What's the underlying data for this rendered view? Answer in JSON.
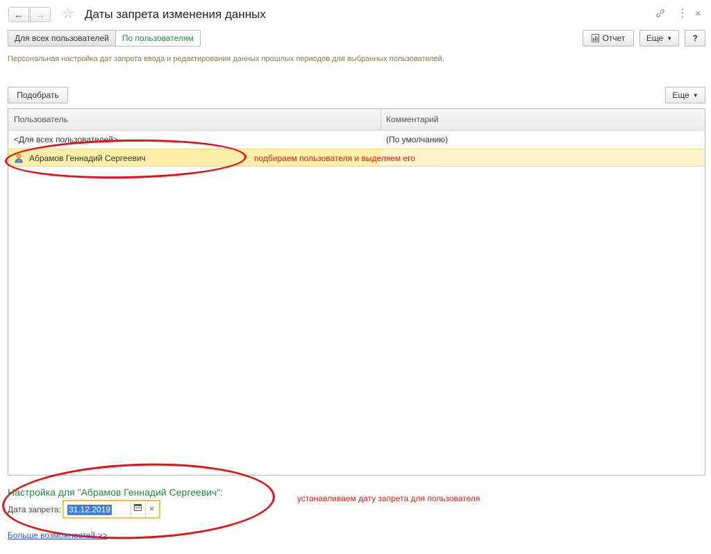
{
  "window": {
    "title": "Даты запрета изменения данных"
  },
  "tabs": [
    {
      "label": "Для всех пользователей",
      "active": false
    },
    {
      "label": "По пользователям",
      "active": true
    }
  ],
  "toolbar": {
    "report_label": "Отчет",
    "more_label": "Еще",
    "help_label": "?"
  },
  "description": "Персональная настройка дат запрета ввода и редактирования данных прошлых периодов для выбранных пользователей.",
  "list_toolbar": {
    "pick_label": "Подобрать",
    "more_label": "Еще"
  },
  "table": {
    "columns": [
      "Пользователь",
      "Комментарий"
    ],
    "rows": [
      {
        "user": "<Для всех пользователей>",
        "comment": "(По умолчанию)",
        "selected": false
      },
      {
        "user": "Абрамов Геннадий Сергеевич",
        "comment": "",
        "selected": true
      }
    ]
  },
  "annotations": {
    "row_note": "подбираем пользователя и выделяем его",
    "date_note": "устанавливаем дату запрета для пользователя"
  },
  "settings": {
    "title": "Настройка для \"Абрамов Геннадий Сергеевич\":",
    "date_label": "Дата запрета:",
    "date_value": "31.12.2019",
    "more_link": "Больше возможностей >>"
  },
  "colors": {
    "accent_green": "#1e8a3b",
    "selection": "#fbeea8",
    "annotation_red": "#e31212",
    "link_blue": "#2b58c8"
  },
  "icons": {
    "back": "arrow-left-icon",
    "forward": "arrow-right-icon",
    "favorite": "star-icon",
    "link": "link-icon",
    "menu": "more-vertical-icon",
    "close": "close-icon",
    "report": "report-icon",
    "user": "user-icon",
    "calendar": "calendar-icon",
    "clear": "clear-icon"
  }
}
